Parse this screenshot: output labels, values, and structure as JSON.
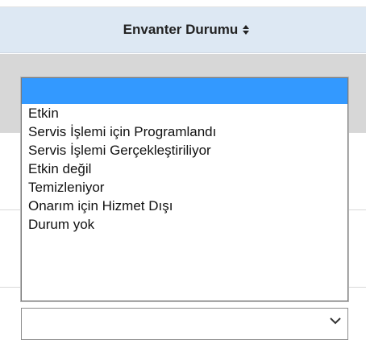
{
  "header": {
    "title": "Envanter Durumu",
    "sort_icon": "sort-updown-icon"
  },
  "listbox": {
    "selected_value": "",
    "options": [
      "",
      "Etkin",
      "Servis İşlemi için Programlandı",
      "Servis İşlemi Gerçekleştiriliyor",
      "Etkin değil",
      "Temizleniyor",
      "Onarım için Hizmet Dışı",
      "Durum yok"
    ]
  },
  "closed_select": {
    "value": "",
    "icon": "chevron-down-icon"
  },
  "colors": {
    "header_bg": "#dde8f3",
    "selected_bg": "#3399ff",
    "row_gray": "#d7d7d7"
  }
}
